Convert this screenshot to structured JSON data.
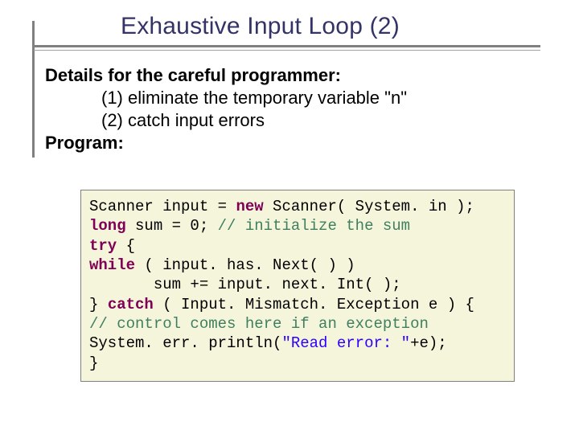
{
  "title": "Exhaustive Input Loop (2)",
  "details_label": "Details for the careful programmer:",
  "points": {
    "p1": "(1) eliminate the temporary variable \"n\"",
    "p2": "(2) catch input errors"
  },
  "program_label": "Program:",
  "code": {
    "l1a": "Scanner input = ",
    "l1_kw_new": "new",
    "l1b": " Scanner( System. in );",
    "l2_kw_long": "long",
    "l2a": " sum = 0; ",
    "l2_cmt": "// initialize the sum",
    "l3_kw_try": "try",
    "l3a": " {",
    "l4_kw_while": "while",
    "l4a": " ( input. has. Next( ) )",
    "l5_indent": "       ",
    "l5a": "sum += input. next. Int( );",
    "l6a": "} ",
    "l6_kw_catch": "catch",
    "l6b": " ( Input. Mismatch. Exception e ) {",
    "l7_cmt": "// control comes here if an exception",
    "l8a": "System. err. println(",
    "l8_str": "\"Read error: \"",
    "l8b": "+e);",
    "l9a": "}"
  }
}
